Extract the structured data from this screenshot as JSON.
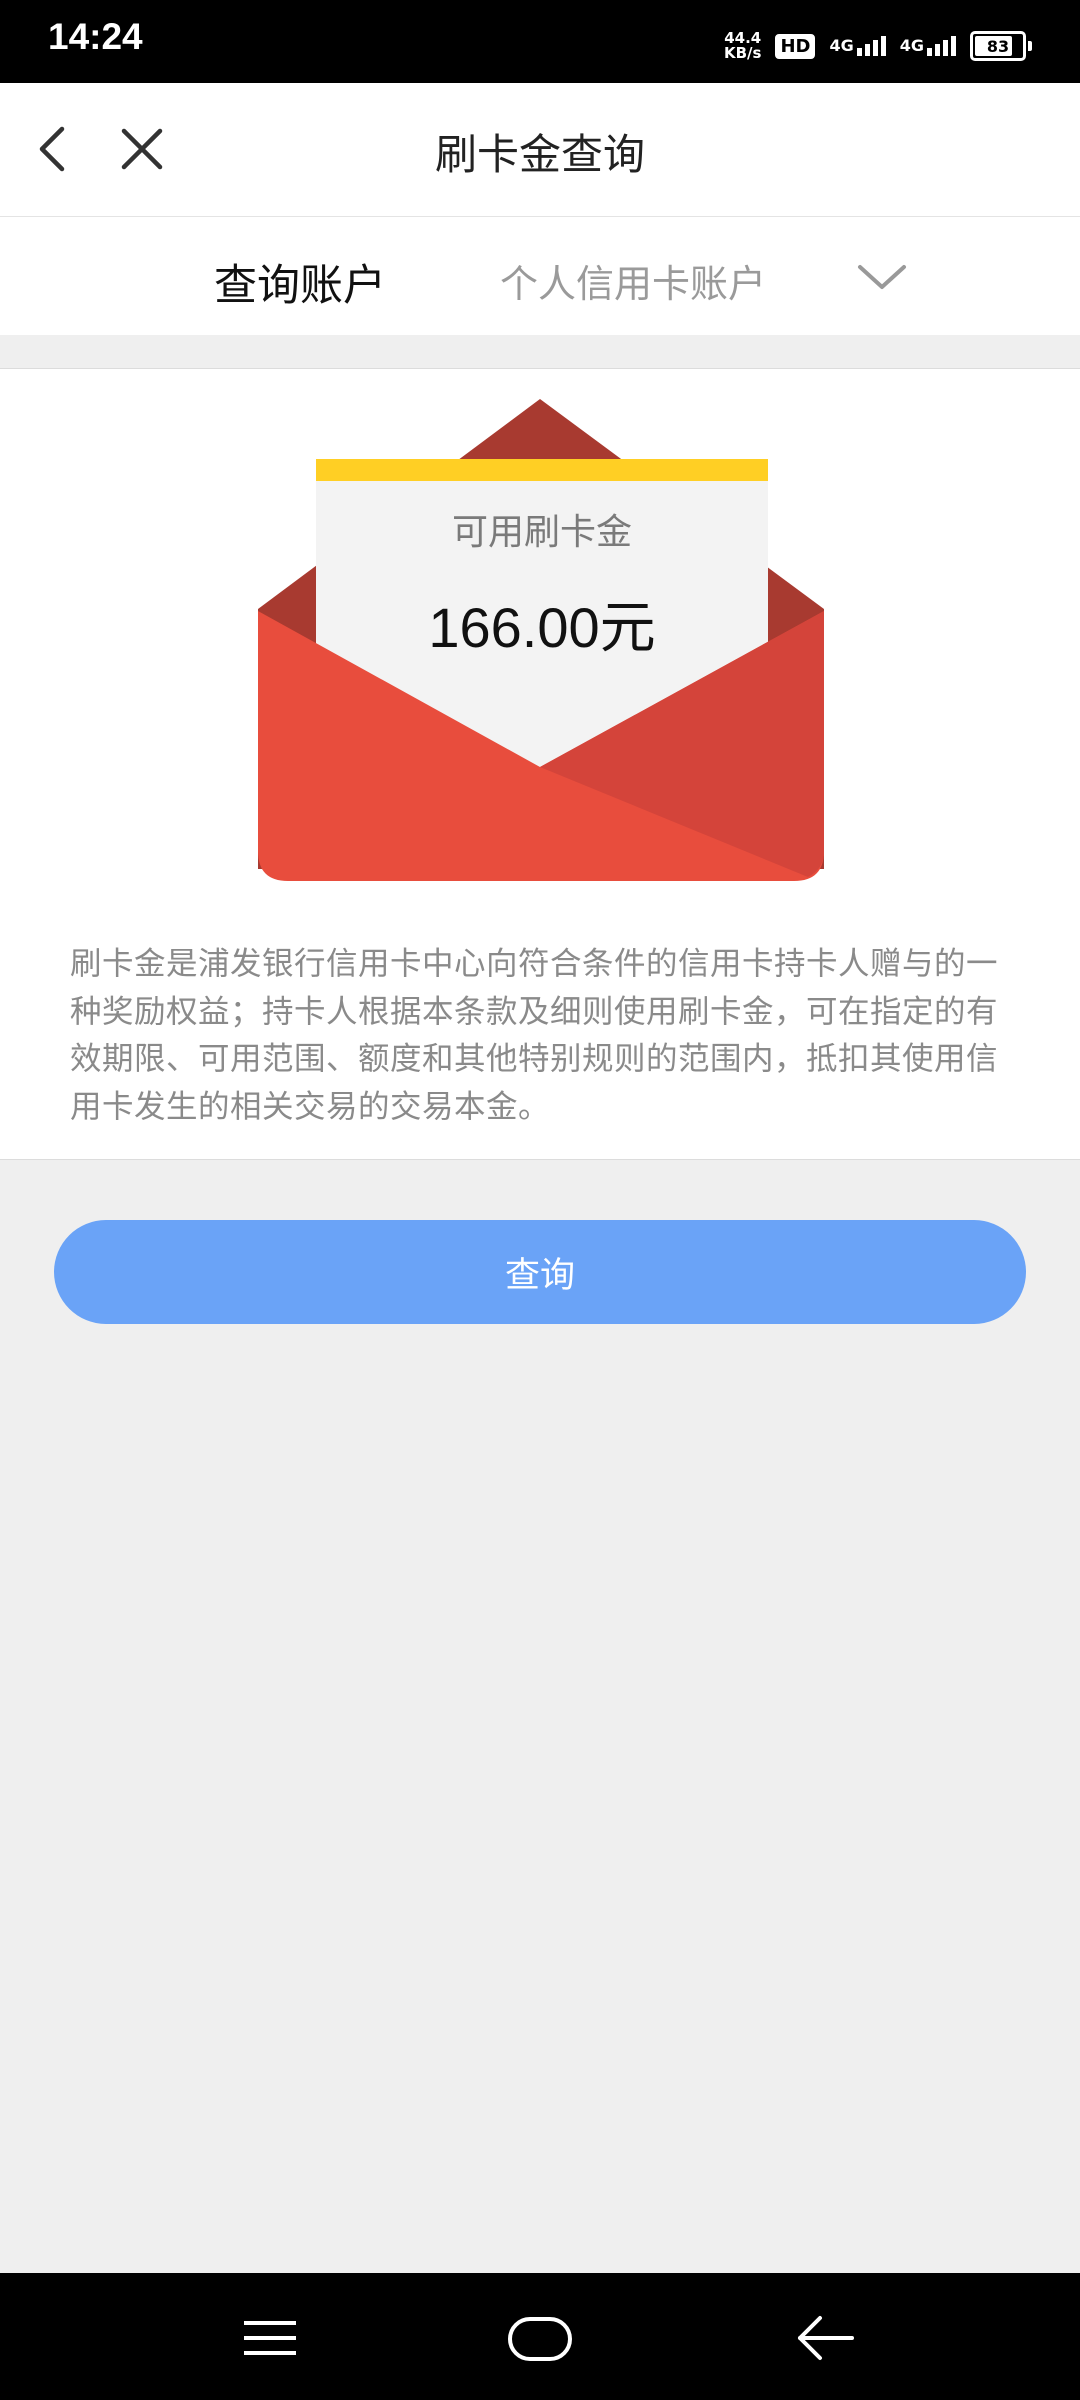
{
  "status_bar": {
    "time": "14:24",
    "net_speed_value": "44.4",
    "net_speed_unit": "KB/s",
    "hd_label": "HD",
    "sim1_label": "4G",
    "sim2_label": "4G",
    "battery": "83",
    "battery_level": 0.83
  },
  "header": {
    "title": "刷卡金查询",
    "back_icon": "chevron-left-icon",
    "close_icon": "close-icon"
  },
  "account": {
    "label": "查询账户",
    "value": "个人信用卡账户",
    "dropdown_icon": "chevron-down-icon"
  },
  "envelope": {
    "label": "可用刷卡金",
    "amount": "166.00元",
    "colors": {
      "envelope": "#e84d3d",
      "envelope_dark": "#a83a30",
      "letter": "#f3f3f3",
      "stripe": "#ffcf24"
    }
  },
  "description": "刷卡金是浦发银行信用卡中心向符合条件的信用卡持卡人赠与的一种奖励权益；持卡人根据本条款及细则使用刷卡金，可在指定的有效期限、可用范围、额度和其他特别规则的范围内，抵扣其使用信用卡发生的相关交易的交易本金。",
  "query_button": {
    "label": "查询",
    "color": "#6aa3f7"
  },
  "system_nav": {
    "menu_icon": "menu-icon",
    "home_icon": "home-icon",
    "back_icon": "back-arrow-icon"
  }
}
